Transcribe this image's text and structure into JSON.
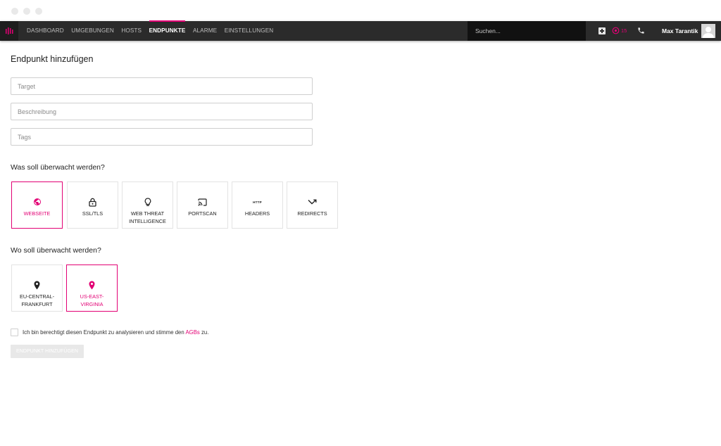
{
  "nav": {
    "items": [
      {
        "label": "DASHBOARD",
        "active": false
      },
      {
        "label": "UMGEBUNGEN",
        "active": false
      },
      {
        "label": "HOSTS",
        "active": false
      },
      {
        "label": "ENDPUNKTE",
        "active": true
      },
      {
        "label": "ALARME",
        "active": false
      },
      {
        "label": "EINSTELLUNGEN",
        "active": false
      }
    ],
    "search_placeholder": "Suchen...",
    "alarm_count": "15",
    "user_name": "Max Tarantik"
  },
  "form": {
    "title": "Endpunkt hinzufügen",
    "target_placeholder": "Target",
    "description_placeholder": "Beschreibung",
    "tags_placeholder": "Tags"
  },
  "monitor_section": {
    "title": "Was soll überwacht werden?",
    "options": [
      {
        "label": "WEBSEITE",
        "icon": "globe-icon",
        "selected": true
      },
      {
        "label": "SSL/TLS",
        "icon": "lock-icon",
        "selected": false
      },
      {
        "label": "WEB THREAT\nINTELLIGENCE",
        "icon": "lightbulb-icon",
        "selected": false
      },
      {
        "label": "PORTSCAN",
        "icon": "cast-icon",
        "selected": false
      },
      {
        "label": "HEADERS",
        "icon": "http-icon",
        "icon_text": "HTTP",
        "selected": false
      },
      {
        "label": "REDIRECTS",
        "icon": "redirect-arrow-icon",
        "selected": false
      }
    ]
  },
  "location_section": {
    "title": "Wo soll überwacht werden?",
    "options": [
      {
        "label": "EU-CENTRAL-\nFRANKFURT",
        "icon": "location-pin-icon",
        "selected": false
      },
      {
        "label": "US-EAST-\nVIRGINIA",
        "icon": "location-pin-icon",
        "selected": true
      }
    ]
  },
  "consent": {
    "prefix": "Ich bin berechtigt diesen Endpunkt zu analysieren und stimme den ",
    "link": "AGBs",
    "suffix": " zu."
  },
  "submit_label": "ENDPUNKT HINZUFÜGEN",
  "colors": {
    "accent": "#e20074",
    "navbar": "#2b2b2b",
    "search_bg": "#111111",
    "border": "#cfcfcf",
    "disabled_button": "#e8e8e8"
  }
}
